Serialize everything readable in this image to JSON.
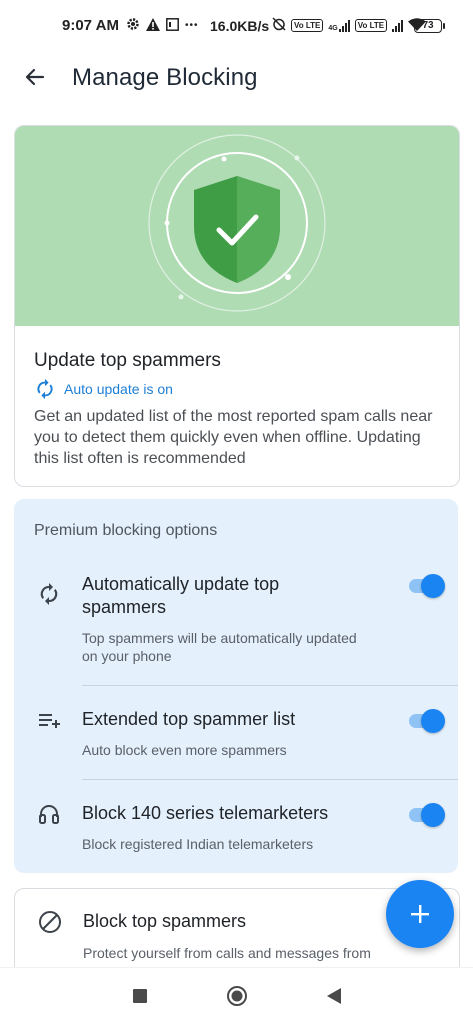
{
  "status_bar": {
    "time": "9:07 AM",
    "notif_icons": [
      "gear-icon",
      "warning-icon",
      "calendar-icon"
    ],
    "more_dots": "•••",
    "net_speed": "16.0KB/s",
    "sim_badges": [
      "Vo LTE",
      "Vo LTE"
    ],
    "network_type": "4G",
    "battery": "73"
  },
  "app_bar": {
    "title": "Manage Blocking"
  },
  "update_card": {
    "title": "Update top spammers",
    "status": "Auto update is on",
    "description": "Get an updated list of the most reported spam calls near you to detect them quickly even when offline. Updating this list often is recommended"
  },
  "premium": {
    "header": "Premium blocking options",
    "options": [
      {
        "icon": "sync-icon",
        "title": "Automatically update top spammers",
        "subtitle": "Top spammers will be automatically updated on your phone",
        "enabled": true
      },
      {
        "icon": "playlist-add-icon",
        "title": "Extended top spammer list",
        "subtitle": "Auto block even more spammers",
        "enabled": true
      },
      {
        "icon": "headset-icon",
        "title": "Block 140 series telemarketers",
        "subtitle": "Block registered Indian telemarketers",
        "enabled": true
      }
    ]
  },
  "block_card": {
    "title": "Block top spammers",
    "description": "Protect yourself from calls and messages from the most reported numbers"
  },
  "colors": {
    "accent": "#1a84f2",
    "hero_green": "#b0dcb4",
    "shield_green": "#3f9d45",
    "premium_bg": "#e4f0fc"
  }
}
